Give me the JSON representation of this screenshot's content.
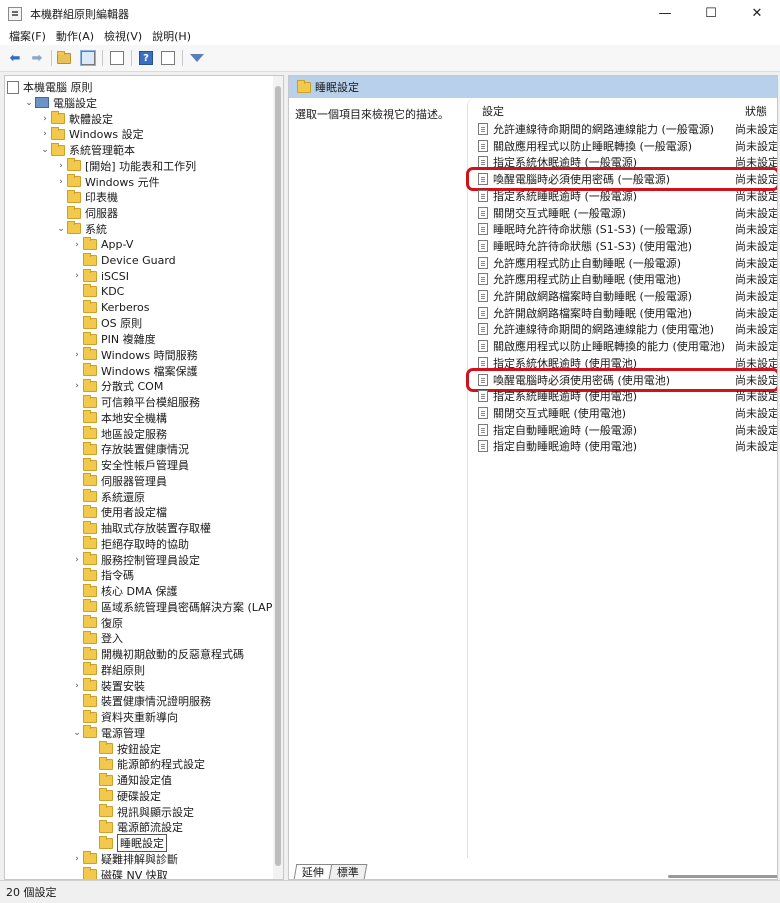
{
  "window": {
    "title": "本機群組原則編輯器",
    "minimize_icon": "minimize-icon",
    "maximize_icon": "maximize-icon",
    "close_icon": "close-icon"
  },
  "menubar": {
    "items": [
      "檔案(F)",
      "動作(A)",
      "檢視(V)",
      "說明(H)"
    ]
  },
  "toolbar": {
    "icons": [
      "back-arrow-icon",
      "forward-arrow-icon",
      "up-folder-icon",
      "show-hide-tree-icon",
      "export-list-icon",
      "help-icon",
      "properties-icon",
      "filter-icon"
    ]
  },
  "tree": {
    "items": [
      {
        "label": "本機電腦 原則",
        "depth": 0,
        "expander": "",
        "icon": "policy"
      },
      {
        "label": "電腦設定",
        "depth": 1,
        "expander": "open",
        "icon": "computer"
      },
      {
        "label": "軟體設定",
        "depth": 2,
        "expander": "closed",
        "icon": "folder"
      },
      {
        "label": "Windows 設定",
        "depth": 2,
        "expander": "closed",
        "icon": "folder"
      },
      {
        "label": "系統管理範本",
        "depth": 2,
        "expander": "open",
        "icon": "folder"
      },
      {
        "label": "[開始] 功能表和工作列",
        "depth": 3,
        "expander": "closed",
        "icon": "folder"
      },
      {
        "label": "Windows 元件",
        "depth": 3,
        "expander": "closed",
        "icon": "folder"
      },
      {
        "label": "印表機",
        "depth": 3,
        "expander": "",
        "icon": "folder"
      },
      {
        "label": "伺服器",
        "depth": 3,
        "expander": "",
        "icon": "folder"
      },
      {
        "label": "系統",
        "depth": 3,
        "expander": "open",
        "icon": "folder"
      },
      {
        "label": "App-V",
        "depth": 4,
        "expander": "closed",
        "icon": "folder"
      },
      {
        "label": "Device Guard",
        "depth": 4,
        "expander": "",
        "icon": "folder"
      },
      {
        "label": "iSCSI",
        "depth": 4,
        "expander": "closed",
        "icon": "folder"
      },
      {
        "label": "KDC",
        "depth": 4,
        "expander": "",
        "icon": "folder"
      },
      {
        "label": "Kerberos",
        "depth": 4,
        "expander": "",
        "icon": "folder"
      },
      {
        "label": "OS 原則",
        "depth": 4,
        "expander": "",
        "icon": "folder"
      },
      {
        "label": "PIN 複雜度",
        "depth": 4,
        "expander": "",
        "icon": "folder"
      },
      {
        "label": "Windows 時間服務",
        "depth": 4,
        "expander": "closed",
        "icon": "folder"
      },
      {
        "label": "Windows 檔案保護",
        "depth": 4,
        "expander": "",
        "icon": "folder"
      },
      {
        "label": "分散式 COM",
        "depth": 4,
        "expander": "closed",
        "icon": "folder"
      },
      {
        "label": "可信賴平台模組服務",
        "depth": 4,
        "expander": "",
        "icon": "folder"
      },
      {
        "label": "本地安全機構",
        "depth": 4,
        "expander": "",
        "icon": "folder"
      },
      {
        "label": "地區設定服務",
        "depth": 4,
        "expander": "",
        "icon": "folder"
      },
      {
        "label": "存放裝置健康情況",
        "depth": 4,
        "expander": "",
        "icon": "folder"
      },
      {
        "label": "安全性帳戶管理員",
        "depth": 4,
        "expander": "",
        "icon": "folder"
      },
      {
        "label": "伺服器管理員",
        "depth": 4,
        "expander": "",
        "icon": "folder"
      },
      {
        "label": "系統還原",
        "depth": 4,
        "expander": "",
        "icon": "folder"
      },
      {
        "label": "使用者設定檔",
        "depth": 4,
        "expander": "",
        "icon": "folder"
      },
      {
        "label": "抽取式存放裝置存取權",
        "depth": 4,
        "expander": "",
        "icon": "folder"
      },
      {
        "label": "拒絕存取時的協助",
        "depth": 4,
        "expander": "",
        "icon": "folder"
      },
      {
        "label": "服務控制管理員設定",
        "depth": 4,
        "expander": "closed",
        "icon": "folder"
      },
      {
        "label": "指令碼",
        "depth": 4,
        "expander": "",
        "icon": "folder"
      },
      {
        "label": "核心 DMA 保護",
        "depth": 4,
        "expander": "",
        "icon": "folder"
      },
      {
        "label": "區域系統管理員密碼解決方案 (LAPS)",
        "depth": 4,
        "expander": "",
        "icon": "folder"
      },
      {
        "label": "復原",
        "depth": 4,
        "expander": "",
        "icon": "folder"
      },
      {
        "label": "登入",
        "depth": 4,
        "expander": "",
        "icon": "folder"
      },
      {
        "label": "開機初期啟動的反惡意程式碼",
        "depth": 4,
        "expander": "",
        "icon": "folder"
      },
      {
        "label": "群組原則",
        "depth": 4,
        "expander": "",
        "icon": "folder"
      },
      {
        "label": "裝置安裝",
        "depth": 4,
        "expander": "closed",
        "icon": "folder"
      },
      {
        "label": "裝置健康情況證明服務",
        "depth": 4,
        "expander": "",
        "icon": "folder"
      },
      {
        "label": "資料夾重新導向",
        "depth": 4,
        "expander": "",
        "icon": "folder"
      },
      {
        "label": "電源管理",
        "depth": 4,
        "expander": "open",
        "icon": "folder"
      },
      {
        "label": "按鈕設定",
        "depth": 5,
        "expander": "",
        "icon": "folder"
      },
      {
        "label": "能源節約程式設定",
        "depth": 5,
        "expander": "",
        "icon": "folder"
      },
      {
        "label": "通知設定值",
        "depth": 5,
        "expander": "",
        "icon": "folder"
      },
      {
        "label": "硬碟設定",
        "depth": 5,
        "expander": "",
        "icon": "folder"
      },
      {
        "label": "視訊與顯示設定",
        "depth": 5,
        "expander": "",
        "icon": "folder"
      },
      {
        "label": "電源節流設定",
        "depth": 5,
        "expander": "",
        "icon": "folder"
      },
      {
        "label": "睡眠設定",
        "depth": 5,
        "expander": "",
        "icon": "folder",
        "selected": true
      },
      {
        "label": "疑難排解與診斷",
        "depth": 4,
        "expander": "closed",
        "icon": "folder"
      },
      {
        "label": "磁碟 NV 快取",
        "depth": 4,
        "expander": "",
        "icon": "folder"
      }
    ]
  },
  "right": {
    "header_title": "睡眠設定",
    "description": "選取一個項目來檢視它的描述。",
    "col_setting": "設定",
    "col_state": "狀態",
    "rows": [
      {
        "name": "允許連線待命期間的網路連線能力 (一般電源)",
        "state": "尚未設定"
      },
      {
        "name": "關啟應用程式以防止睡眠轉換 (一般電源)",
        "state": "尚未設定"
      },
      {
        "name": "指定系統休眠逾時 (一般電源)",
        "state": "尚未設定"
      },
      {
        "name": "喚醒電腦時必須使用密碼 (一般電源)",
        "state": "尚未設定",
        "highlighted": true
      },
      {
        "name": "指定系統睡眠逾時 (一般電源)",
        "state": "尚未設定"
      },
      {
        "name": "關閉交互式睡眠 (一般電源)",
        "state": "尚未設定"
      },
      {
        "name": "睡眠時允許待命狀態 (S1-S3) (一般電源)",
        "state": "尚未設定"
      },
      {
        "name": "睡眠時允許待命狀態 (S1-S3) (使用電池)",
        "state": "尚未設定"
      },
      {
        "name": "允許應用程式防止自動睡眠 (一般電源)",
        "state": "尚未設定"
      },
      {
        "name": "允許應用程式防止自動睡眠 (使用電池)",
        "state": "尚未設定"
      },
      {
        "name": "允許開啟網路檔案時自動睡眠 (一般電源)",
        "state": "尚未設定"
      },
      {
        "name": "允許開啟網路檔案時自動睡眠 (使用電池)",
        "state": "尚未設定"
      },
      {
        "name": "允許連線待命期間的網路連線能力 (使用電池)",
        "state": "尚未設定"
      },
      {
        "name": "關啟應用程式以防止睡眠轉換的能力 (使用電池)",
        "state": "尚未設定"
      },
      {
        "name": "指定系統休眠逾時 (使用電池)",
        "state": "尚未設定"
      },
      {
        "name": "喚醒電腦時必須使用密碼 (使用電池)",
        "state": "尚未設定",
        "highlighted": true
      },
      {
        "name": "指定系統睡眠逾時 (使用電池)",
        "state": "尚未設定"
      },
      {
        "name": "關閉交互式睡眠 (使用電池)",
        "state": "尚未設定"
      },
      {
        "name": "指定自動睡眠逾時 (一般電源)",
        "state": "尚未設定"
      },
      {
        "name": "指定自動睡眠逾時 (使用電池)",
        "state": "尚未設定"
      }
    ],
    "tabs": [
      "延伸",
      "標準"
    ]
  },
  "status": {
    "text": "20 個設定"
  },
  "colors": {
    "highlight": "#d0121b",
    "header_bg": "#b8d0ea"
  }
}
